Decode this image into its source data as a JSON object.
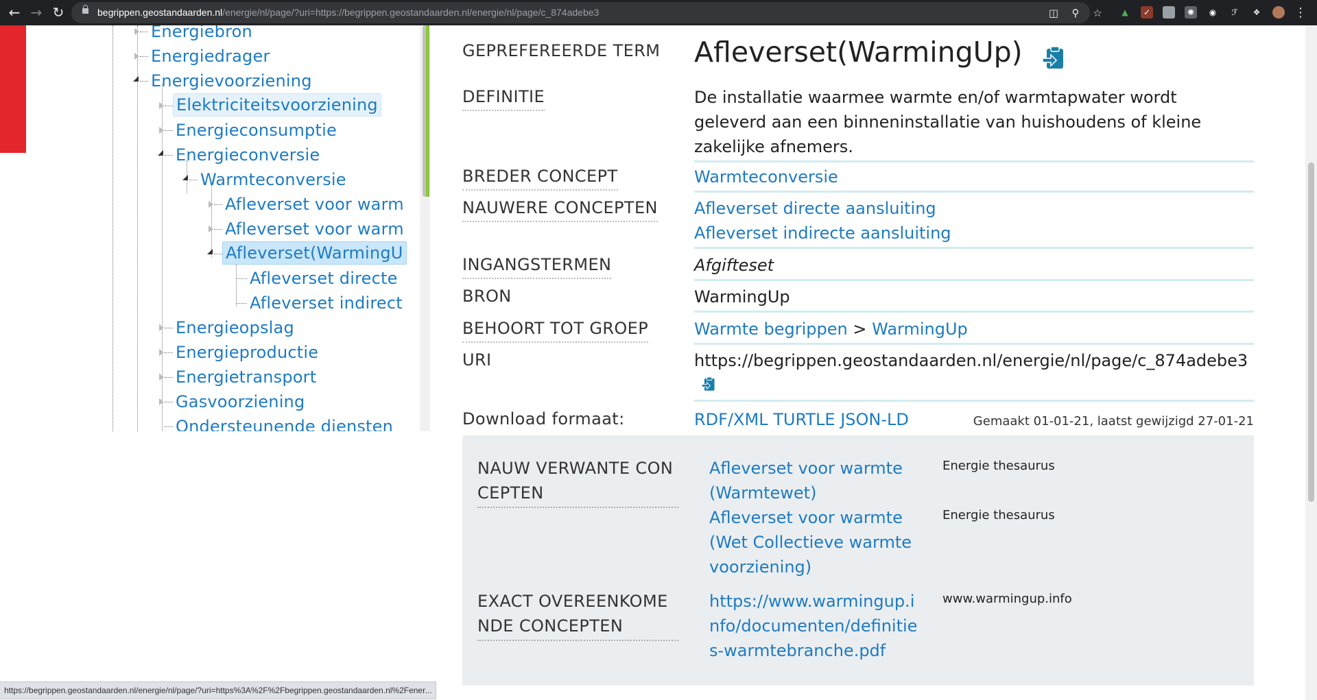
{
  "browser": {
    "url_host": "begrippen.geostandaarden.nl",
    "url_rest": "/energie/nl/page/?uri=https://begrippen.geostandaarden.nl/energie/nl/page/c_874adebe3",
    "status_url": "https://begrippen.geostandaarden.nl/energie/nl/page/?uri=https%3A%2F%2Fbegrippen.geostandaarden.nl%2Fener..."
  },
  "tree": {
    "nodes": [
      {
        "label": "Energiebron"
      },
      {
        "label": "Energiedrager"
      },
      {
        "label": "Energievoorziening"
      },
      {
        "label": "Elektriciteitsvoorziening"
      },
      {
        "label": "Energieconsumptie"
      },
      {
        "label": "Energieconversie"
      },
      {
        "label": "Warmteconversie"
      },
      {
        "label": "Afleverset voor warm"
      },
      {
        "label": "Afleverset voor warm"
      },
      {
        "label": "Afleverset(WarmingU"
      },
      {
        "label": "Afleverset directe"
      },
      {
        "label": "Afleverset indirect"
      },
      {
        "label": "Energieopslag"
      },
      {
        "label": "Energieproductie"
      },
      {
        "label": "Energietransport"
      },
      {
        "label": "Gasvoorziening"
      },
      {
        "label": "Ondersteunende diensten"
      }
    ]
  },
  "concept": {
    "preferred_label": "GEPREFEREERDE TERM",
    "preferred_value": "Afleverset(WarmingUp)",
    "definition_label": "DEFINITIE",
    "definition_value": "De installatie waarmee warmte en/of warmtapwater wordt geleverd aan een binneninstallatie van huishoudens of kleine zakelijke afnemers.",
    "broader_label": "BREDER CONCEPT",
    "broader_value": "Warmteconversie",
    "narrower_label": "NAUWERE CONCEPTEN",
    "narrower_values": [
      "Afleverset directe aansluiting",
      "Afleverset indirecte aansluiting"
    ],
    "entry_label": "INGANGSTERMEN",
    "entry_value": "Afgifteset",
    "source_label": "BRON",
    "source_value": "WarmingUp",
    "group_label": "BEHOORT TOT GROEP",
    "group_link1": "Warmte begrippen",
    "group_sep": ">",
    "group_link2": "WarmingUp",
    "uri_label": "URI",
    "uri_value": "https://begrippen.geostandaarden.nl/energie/nl/page/c_874adebe3",
    "download_label": "Download formaat:",
    "download_rdf": "RDF/XML",
    "download_turtle": "TURTLE",
    "download_jsonld": "JSON-LD",
    "meta": "Gemaakt 01-01-21, laatst gewijzigd 27-01-21"
  },
  "related": {
    "close_label": "NAUW VERWANTE CONCEPTEN",
    "close_items": [
      {
        "link": "Afleverset voor warmte(Warmtewet)",
        "source": "Energie thesaurus"
      },
      {
        "link": "Afleverset voor warmte(Wet Collectieve warmtevoorziening)",
        "source": "Energie thesaurus"
      }
    ],
    "exact_label": "EXACT OVEREENKOMENDE CONCEPTEN",
    "exact_items": [
      {
        "link": "https://www.warmingup.info/documenten/definities-warmtebranche.pdf",
        "source": "www.warmingup.info"
      }
    ]
  },
  "colors": {
    "accent": "#1e7bc2",
    "brand_red": "#e3262b",
    "divider": "#d2ecef",
    "tree_scroll_accent": "#8dc63f"
  }
}
